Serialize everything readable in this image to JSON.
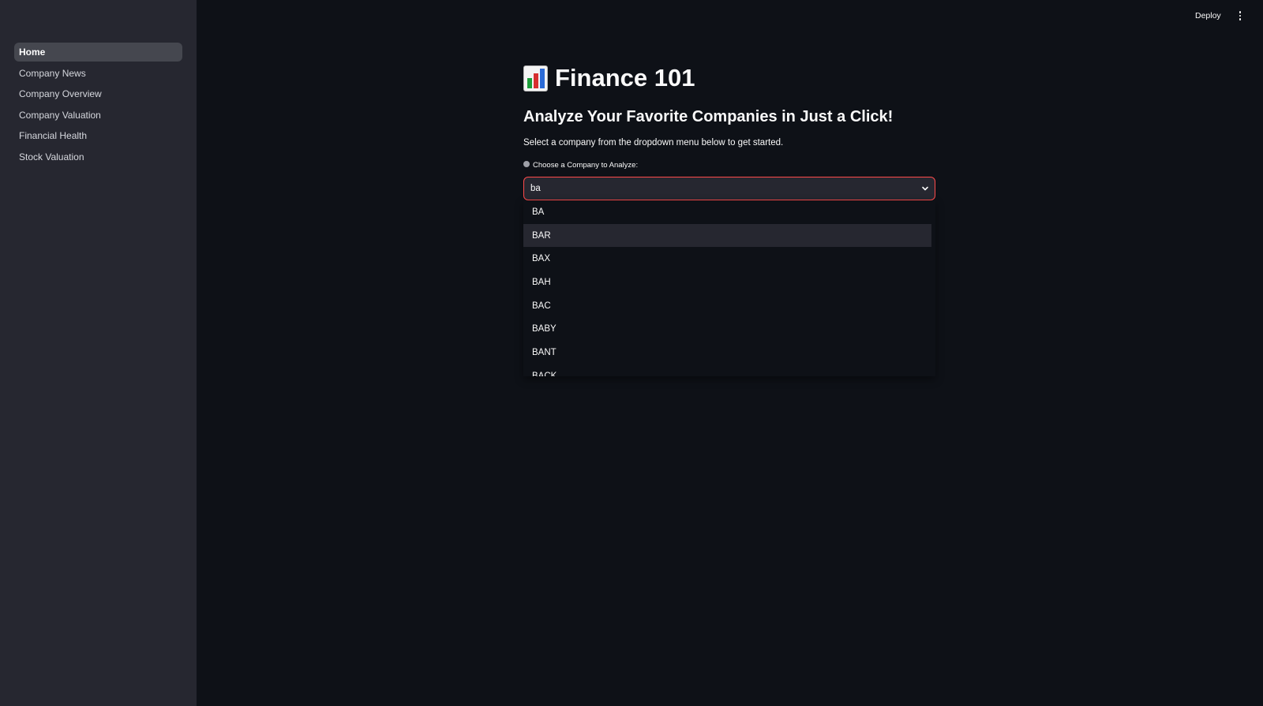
{
  "header": {
    "deploy_label": "Deploy",
    "menu_icon": "kebab-menu-icon"
  },
  "sidebar": {
    "items": [
      {
        "label": "Home",
        "active": true
      },
      {
        "label": "Company News",
        "active": false
      },
      {
        "label": "Company Overview",
        "active": false
      },
      {
        "label": "Company Valuation",
        "active": false
      },
      {
        "label": "Financial Health",
        "active": false
      },
      {
        "label": "Stock Valuation",
        "active": false
      }
    ]
  },
  "main": {
    "title_icon": "bar-chart-emoji-icon",
    "title": "Finance 101",
    "subtitle": "Analyze Your Favorite Companies in Just a Click!",
    "description": "Select a company from the dropdown menu below to get started.",
    "select": {
      "label": "Choose a Company to Analyze:",
      "value": "ba",
      "options": [
        "BA",
        "BAR",
        "BAX",
        "BAH",
        "BAC",
        "BABY",
        "BANT",
        "BACK"
      ],
      "highlighted": "BAR"
    }
  },
  "colors": {
    "background": "#0e1117",
    "sidebar": "#262730",
    "accent": "#ff4b4b",
    "text": "#fafafa"
  }
}
